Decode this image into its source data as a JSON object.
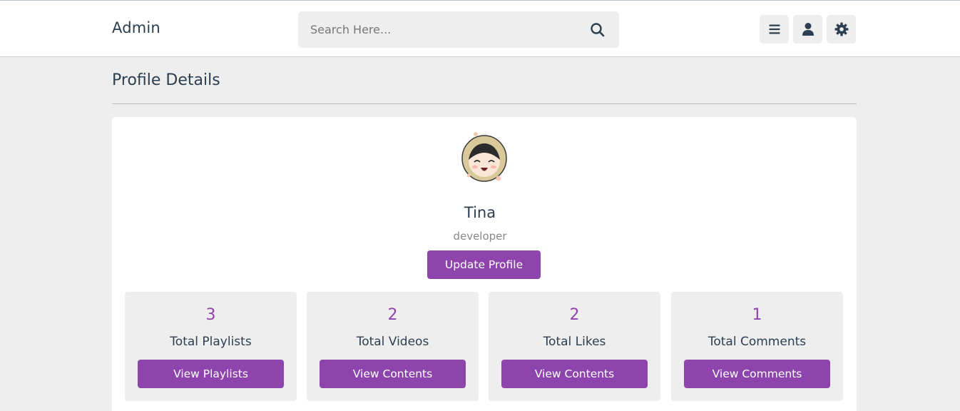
{
  "header": {
    "logo": "Admin",
    "search_placeholder": "Search Here...",
    "icons": [
      "menu-icon",
      "user-icon",
      "settings-gear-icon"
    ]
  },
  "page": {
    "title": "Profile Details"
  },
  "profile": {
    "name": "Tina",
    "role": "developer",
    "update_button": "Update Profile"
  },
  "stats": [
    {
      "value": "3",
      "label": "Total Playlists",
      "button": "View Playlists"
    },
    {
      "value": "2",
      "label": "Total Videos",
      "button": "View Contents"
    },
    {
      "value": "2",
      "label": "Total Likes",
      "button": "View Contents"
    },
    {
      "value": "1",
      "label": "Total Comments",
      "button": "View Comments"
    }
  ],
  "colors": {
    "accent": "#8e44ad",
    "text": "#2c3e50",
    "background": "#eeeeee"
  }
}
